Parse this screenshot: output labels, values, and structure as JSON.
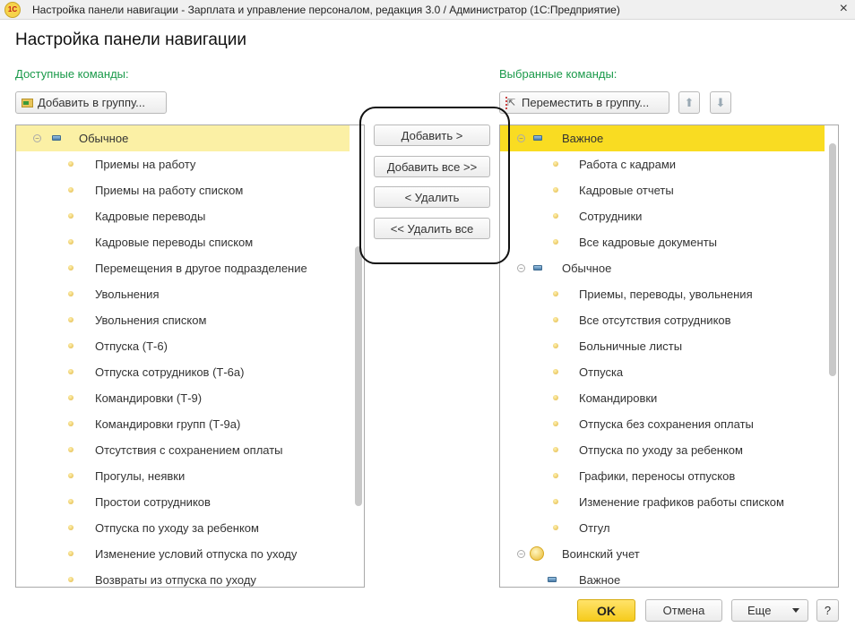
{
  "window": {
    "title": "Настройка панели навигации - Зарплата и управление персоналом, редакция 3.0 / Администратор  (1С:Предприятие)",
    "logo": "1С",
    "close": "×"
  },
  "heading": "Настройка панели навигации",
  "left": {
    "label": "Доступные команды:",
    "add_to_group": "Добавить в группу...",
    "items": [
      {
        "t": "group",
        "text": "Обычное",
        "sel": true
      },
      {
        "t": "item",
        "text": "Приемы на работу"
      },
      {
        "t": "item",
        "text": "Приемы на работу списком"
      },
      {
        "t": "item",
        "text": "Кадровые переводы"
      },
      {
        "t": "item",
        "text": "Кадровые переводы списком"
      },
      {
        "t": "item",
        "text": "Перемещения в другое подразделение"
      },
      {
        "t": "item",
        "text": "Увольнения"
      },
      {
        "t": "item",
        "text": "Увольнения списком"
      },
      {
        "t": "item",
        "text": "Отпуска (Т-6)"
      },
      {
        "t": "item",
        "text": "Отпуска сотрудников (Т-6а)"
      },
      {
        "t": "item",
        "text": "Командировки (Т-9)"
      },
      {
        "t": "item",
        "text": "Командировки групп (Т-9а)"
      },
      {
        "t": "item",
        "text": "Отсутствия с сохранением оплаты"
      },
      {
        "t": "item",
        "text": "Прогулы, неявки"
      },
      {
        "t": "item",
        "text": "Простои сотрудников"
      },
      {
        "t": "item",
        "text": "Отпуска по уходу за ребенком"
      },
      {
        "t": "item",
        "text": "Изменение условий отпуска по уходу"
      },
      {
        "t": "item",
        "text": "Возвраты из отпуска по уходу"
      }
    ]
  },
  "middle": {
    "add": "Добавить >",
    "add_all": "Добавить все >>",
    "remove": "< Удалить",
    "remove_all": "<< Удалить все"
  },
  "right": {
    "label": "Выбранные команды:",
    "move_to_group": "Переместить в группу...",
    "items": [
      {
        "t": "group",
        "text": "Важное",
        "sel": true
      },
      {
        "t": "item",
        "text": "Работа с кадрами"
      },
      {
        "t": "item",
        "text": "Кадровые отчеты"
      },
      {
        "t": "item",
        "text": "Сотрудники"
      },
      {
        "t": "item",
        "text": "Все кадровые документы"
      },
      {
        "t": "group",
        "text": "Обычное"
      },
      {
        "t": "item",
        "text": "Приемы, переводы, увольнения"
      },
      {
        "t": "item",
        "text": "Все отсутствия сотрудников"
      },
      {
        "t": "item",
        "text": "Больничные листы"
      },
      {
        "t": "item",
        "text": "Отпуска"
      },
      {
        "t": "item",
        "text": "Командировки"
      },
      {
        "t": "item",
        "text": "Отпуска без сохранения оплаты"
      },
      {
        "t": "item",
        "text": "Отпуска по уходу за ребенком"
      },
      {
        "t": "item",
        "text": "Графики, переносы отпусков"
      },
      {
        "t": "item",
        "text": "Изменение графиков работы списком"
      },
      {
        "t": "item",
        "text": "Отгул"
      },
      {
        "t": "section",
        "text": "Воинский учет"
      },
      {
        "t": "subgroup",
        "text": "Важное"
      }
    ]
  },
  "footer": {
    "ok": "OK",
    "cancel": "Отмена",
    "more": "Еще",
    "help": "?"
  }
}
